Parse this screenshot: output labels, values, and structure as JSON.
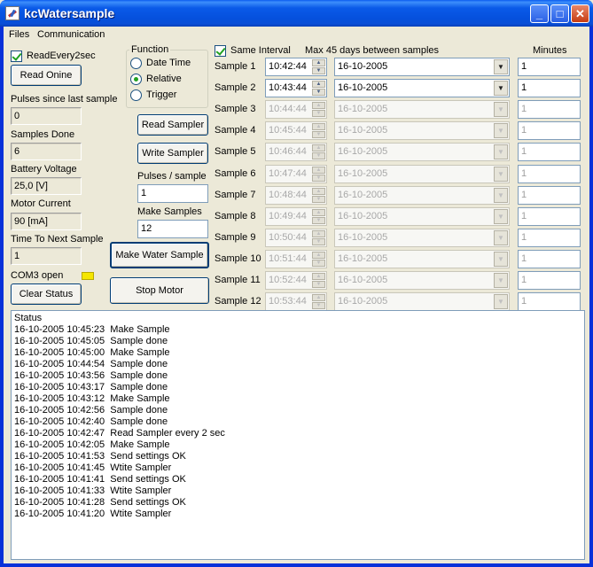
{
  "window": {
    "title": "kcWatersample",
    "minimize_glyph": "_",
    "maximize_glyph": "□",
    "close_glyph": "✕"
  },
  "menu": [
    "Files",
    "Communication"
  ],
  "left": {
    "read_every_label": "ReadEvery2sec",
    "read_every_checked": true,
    "read_online_label": "Read Onine",
    "pulses_since_label": "Pulses since last sample",
    "pulses_since_value": "0",
    "samples_done_label": "Samples Done",
    "samples_done_value": "6",
    "battery_label": "Battery Voltage",
    "battery_value": "25,0 [V]",
    "motor_label": "Motor Current",
    "motor_value": "90 [mA]",
    "time_next_label": "Time To Next Sample",
    "time_next_value": "1",
    "com_status": "COM3 open",
    "clear_status_label": "Clear Status"
  },
  "function": {
    "title": "Function",
    "options": [
      "Date Time",
      "Relative",
      "Trigger"
    ],
    "selected": 1
  },
  "middle": {
    "read_sampler_label": "Read Sampler",
    "write_sampler_label": "Write Sampler",
    "pulses_per_sample_label": "Pulses / sample",
    "pulses_per_sample_value": "1",
    "make_samples_label": "Make Samples",
    "make_samples_value": "12",
    "make_water_sample_label": "Make Water Sample",
    "stop_motor_label": "Stop Motor"
  },
  "samples_header": {
    "same_interval_label": "Same Interval",
    "same_interval_checked": true,
    "max_days_note": "Max 45 days between samples",
    "minutes_label": "Minutes"
  },
  "samples": [
    {
      "label": "Sample 1",
      "time": "10:42:44",
      "date": "16-10-2005",
      "minutes": "1",
      "enabled": true
    },
    {
      "label": "Sample 2",
      "time": "10:43:44",
      "date": "16-10-2005",
      "minutes": "1",
      "enabled": true
    },
    {
      "label": "Sample 3",
      "time": "10:44:44",
      "date": "16-10-2005",
      "minutes": "1",
      "enabled": false
    },
    {
      "label": "Sample 4",
      "time": "10:45:44",
      "date": "16-10-2005",
      "minutes": "1",
      "enabled": false
    },
    {
      "label": "Sample 5",
      "time": "10:46:44",
      "date": "16-10-2005",
      "minutes": "1",
      "enabled": false
    },
    {
      "label": "Sample 6",
      "time": "10:47:44",
      "date": "16-10-2005",
      "minutes": "1",
      "enabled": false
    },
    {
      "label": "Sample 7",
      "time": "10:48:44",
      "date": "16-10-2005",
      "minutes": "1",
      "enabled": false
    },
    {
      "label": "Sample 8",
      "time": "10:49:44",
      "date": "16-10-2005",
      "minutes": "1",
      "enabled": false
    },
    {
      "label": "Sample 9",
      "time": "10:50:44",
      "date": "16-10-2005",
      "minutes": "1",
      "enabled": false
    },
    {
      "label": "Sample 10",
      "time": "10:51:44",
      "date": "16-10-2005",
      "minutes": "1",
      "enabled": false
    },
    {
      "label": "Sample 11",
      "time": "10:52:44",
      "date": "16-10-2005",
      "minutes": "1",
      "enabled": false
    },
    {
      "label": "Sample 12",
      "time": "10:53:44",
      "date": "16-10-2005",
      "minutes": "1",
      "enabled": false
    }
  ],
  "status_log": [
    "Status",
    "16-10-2005 10:45:23  Make Sample",
    "16-10-2005 10:45:05  Sample done",
    "16-10-2005 10:45:00  Make Sample",
    "16-10-2005 10:44:54  Sample done",
    "16-10-2005 10:43:56  Sample done",
    "16-10-2005 10:43:17  Sample done",
    "16-10-2005 10:43:12  Make Sample",
    "16-10-2005 10:42:56  Sample done",
    "16-10-2005 10:42:40  Sample done",
    "16-10-2005 10:42:47  Read Sampler every 2 sec",
    "16-10-2005 10:42:05  Make Sample",
    "16-10-2005 10:41:53  Send settings OK",
    "16-10-2005 10:41:45  Wtite Sampler",
    "16-10-2005 10:41:41  Send settings OK",
    "16-10-2005 10:41:33  Wtite Sampler",
    "16-10-2005 10:41:28  Send settings OK",
    "16-10-2005 10:41:20  Wtite Sampler"
  ],
  "colors": {
    "title_bar": "#0a5ae8",
    "led": "#f5e600",
    "check": "#21a121"
  }
}
